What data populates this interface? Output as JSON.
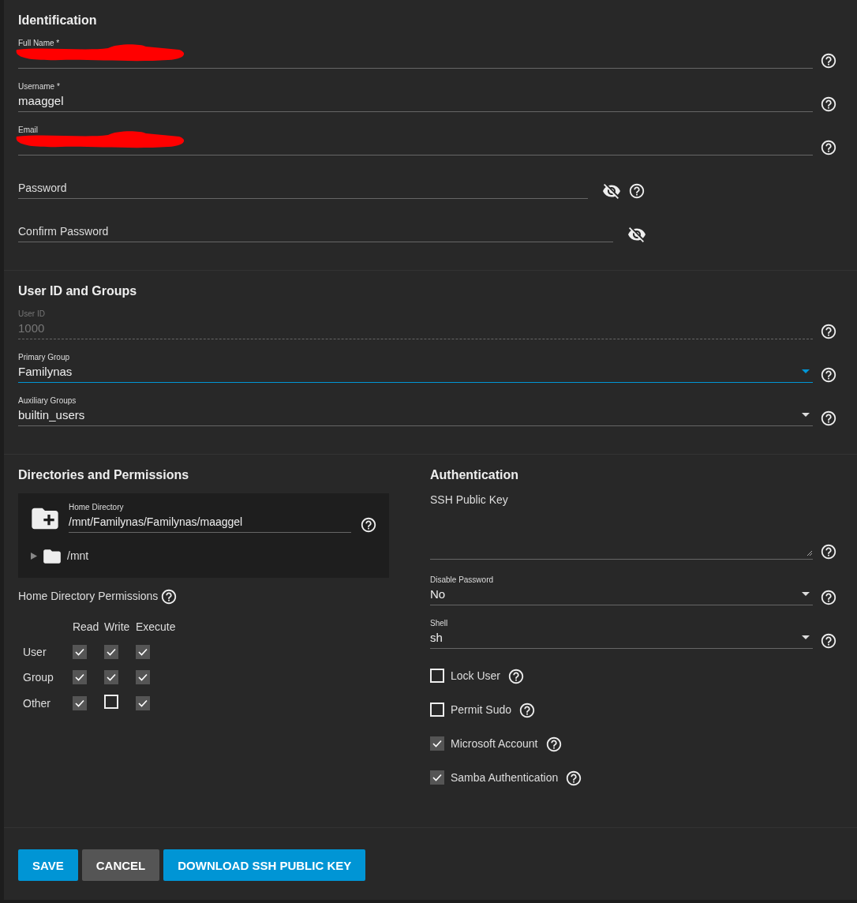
{
  "identification": {
    "title": "Identification",
    "fields": [
      {
        "kind": "text",
        "label": "Full Name *",
        "redacted": true,
        "help": true
      },
      {
        "kind": "text",
        "label": "Username *",
        "value": "maaggel",
        "help": true
      },
      {
        "kind": "text",
        "label": "Email",
        "redacted": true,
        "help": true
      },
      {
        "kind": "password",
        "placeholder": "Password",
        "help": true
      },
      {
        "kind": "password",
        "placeholder": "Confirm Password",
        "help": false
      }
    ]
  },
  "user_id_and_groups": {
    "title": "User ID and Groups",
    "fields": [
      {
        "kind": "text",
        "label": "User ID",
        "value": "1000",
        "disabled": true,
        "help": true
      },
      {
        "kind": "select",
        "label": "Primary Group",
        "value": "Familynas",
        "focused": true,
        "help": true
      },
      {
        "kind": "select",
        "label": "Auxiliary Groups",
        "value": "builtin_users",
        "focused": false,
        "help": true
      }
    ]
  },
  "directories_and_permissions": {
    "title": "Directories and Permissions",
    "home_directory": {
      "label": "Home Directory",
      "value": "/mnt/Familynas/Familynas/maaggel"
    },
    "tree": [
      {
        "label": "/mnt",
        "expanded": false
      }
    ],
    "permissions": {
      "title": "Home Directory Permissions",
      "columns": [
        "Read",
        "Write",
        "Execute"
      ],
      "rows": [
        {
          "label": "User",
          "cells": [
            {
              "checked": true
            },
            {
              "checked": true
            },
            {
              "checked": true
            }
          ]
        },
        {
          "label": "Group",
          "cells": [
            {
              "checked": true
            },
            {
              "checked": true
            },
            {
              "checked": true
            }
          ]
        },
        {
          "label": "Other",
          "cells": [
            {
              "checked": true
            },
            {
              "checked": false
            },
            {
              "checked": true
            }
          ]
        }
      ]
    }
  },
  "authentication": {
    "title": "Authentication",
    "ssh_key": {
      "placeholder": "SSH Public Key"
    },
    "fields": [
      {
        "kind": "select",
        "label": "Disable Password",
        "value": "No",
        "focused": false,
        "help": true
      },
      {
        "kind": "select",
        "label": "Shell",
        "value": "sh",
        "focused": false,
        "help": true
      }
    ],
    "checkboxes": [
      {
        "label": "Lock User",
        "checked": false
      },
      {
        "label": "Permit Sudo",
        "checked": false
      },
      {
        "label": "Microsoft Account",
        "checked": true
      },
      {
        "label": "Samba Authentication",
        "checked": true
      }
    ]
  },
  "buttons": [
    {
      "label": "SAVE",
      "kind": "primary"
    },
    {
      "label": "CANCEL",
      "kind": "secondary"
    },
    {
      "label": "DOWNLOAD SSH PUBLIC KEY",
      "kind": "primary"
    }
  ]
}
